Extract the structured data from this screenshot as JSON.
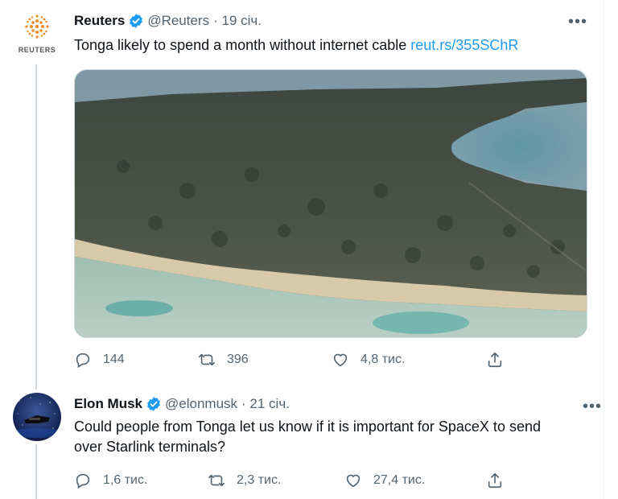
{
  "tweets": [
    {
      "name": "Reuters",
      "handle": "@Reuters",
      "time": "· 19 січ.",
      "text": "Tonga likely to spend a month without internet cable",
      "link": "reut.rs/355SChR",
      "avatar_caption": "REUTERS",
      "replies": "144",
      "retweets": "396",
      "likes": "4,8 тис.",
      "more": "•••"
    },
    {
      "name": "Elon Musk",
      "handle": "@elonmusk",
      "time": "· 21 січ.",
      "text_line1": "Could people from Tonga let us know if it is important for SpaceX to send",
      "text_line2": "over Starlink terminals?",
      "replies": "1,6 тис.",
      "retweets": "2,3 тис.",
      "likes": "27,4 тис.",
      "more": "•••"
    }
  ],
  "colors": {
    "verified": "#1d9bf0",
    "link": "#1d9bf0",
    "muted": "#536471",
    "reuters_orange": "#f08a24"
  },
  "icons": [
    "reply-icon",
    "retweet-icon",
    "like-icon",
    "share-icon",
    "verified-badge-icon",
    "more-icon"
  ]
}
